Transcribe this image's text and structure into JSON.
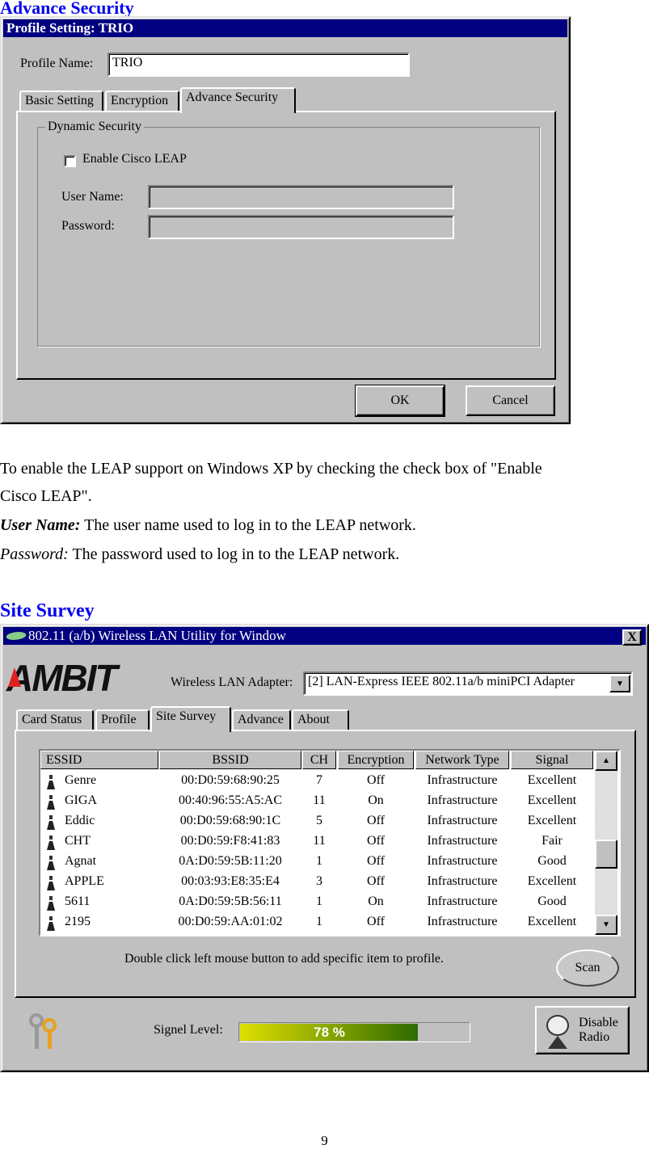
{
  "section1": {
    "heading": "Advance Security"
  },
  "dialog1": {
    "title": "Profile Setting: TRIO",
    "profile_name_label": "Profile Name:",
    "profile_name_value": "TRIO",
    "tabs": [
      "Basic Setting",
      "Encryption",
      "Advance Security"
    ],
    "active_tab": "Advance Security",
    "group_label": "Dynamic Security",
    "checkbox_label": "Enable Cisco LEAP",
    "checkbox_checked": false,
    "user_name_label": "User Name:",
    "user_name_value": "",
    "password_label": "Password:",
    "password_value": "",
    "ok_label": "OK",
    "cancel_label": "Cancel"
  },
  "text": {
    "p1_line1": "To enable the LEAP support on Windows XP by checking the check box of \"Enable",
    "p1_line2": "Cisco LEAP\".",
    "user_term": "User Name:",
    "user_desc": " The user name used to log in to the LEAP network.",
    "pass_term": "Password:",
    "pass_desc": " The password used to log in to the LEAP network."
  },
  "section2": {
    "heading": "Site Survey"
  },
  "dialog2": {
    "title": "802.11 (a/b) Wireless LAN Utility for Window",
    "close_label": "X",
    "logo": "AMBIT",
    "adapter_label": "Wireless LAN Adapter:",
    "adapter_value": "[2] LAN-Express IEEE 802.11a/b miniPCI Adapter",
    "tabs": [
      "Card Status",
      "Profile",
      "Site Survey",
      "Advance",
      "About"
    ],
    "active_tab": "Site Survey",
    "columns": [
      "ESSID",
      "BSSID",
      "CH",
      "Encryption",
      "Network Type",
      "Signal"
    ],
    "rows": [
      [
        "Genre",
        "00:D0:59:68:90:25",
        "7",
        "Off",
        "Infrastructure",
        "Excellent"
      ],
      [
        "GIGA",
        "00:40:96:55:A5:AC",
        "11",
        "On",
        "Infrastructure",
        "Excellent"
      ],
      [
        "Eddic",
        "00:D0:59:68:90:1C",
        "5",
        "Off",
        "Infrastructure",
        "Excellent"
      ],
      [
        "CHT",
        "00:D0:59:F8:41:83",
        "11",
        "Off",
        "Infrastructure",
        "Fair"
      ],
      [
        "Agnat",
        "0A:D0:59:5B:11:20",
        "1",
        "Off",
        "Infrastructure",
        "Good"
      ],
      [
        "APPLE",
        "00:03:93:E8:35:E4",
        "3",
        "Off",
        "Infrastructure",
        "Excellent"
      ],
      [
        "5611",
        "0A:D0:59:5B:56:11",
        "1",
        "On",
        "Infrastructure",
        "Good"
      ],
      [
        "2195",
        "00:D0:59:AA:01:02",
        "1",
        "Off",
        "Infrastructure",
        "Excellent"
      ]
    ],
    "hint": "Double click left mouse button to add specific item to profile.",
    "scan_label": "Scan",
    "signal_label": "Signel Level:",
    "signal_text": "78 %",
    "signal_percent": 78,
    "disable_line1": "Disable",
    "disable_line2": "Radio"
  },
  "page_number": "9",
  "colors": {
    "heading": "#0000ee",
    "titlebar": "#000080",
    "window": "#c0c0c0",
    "signal_start": "#e0e000",
    "signal_end": "#2e6b00"
  }
}
